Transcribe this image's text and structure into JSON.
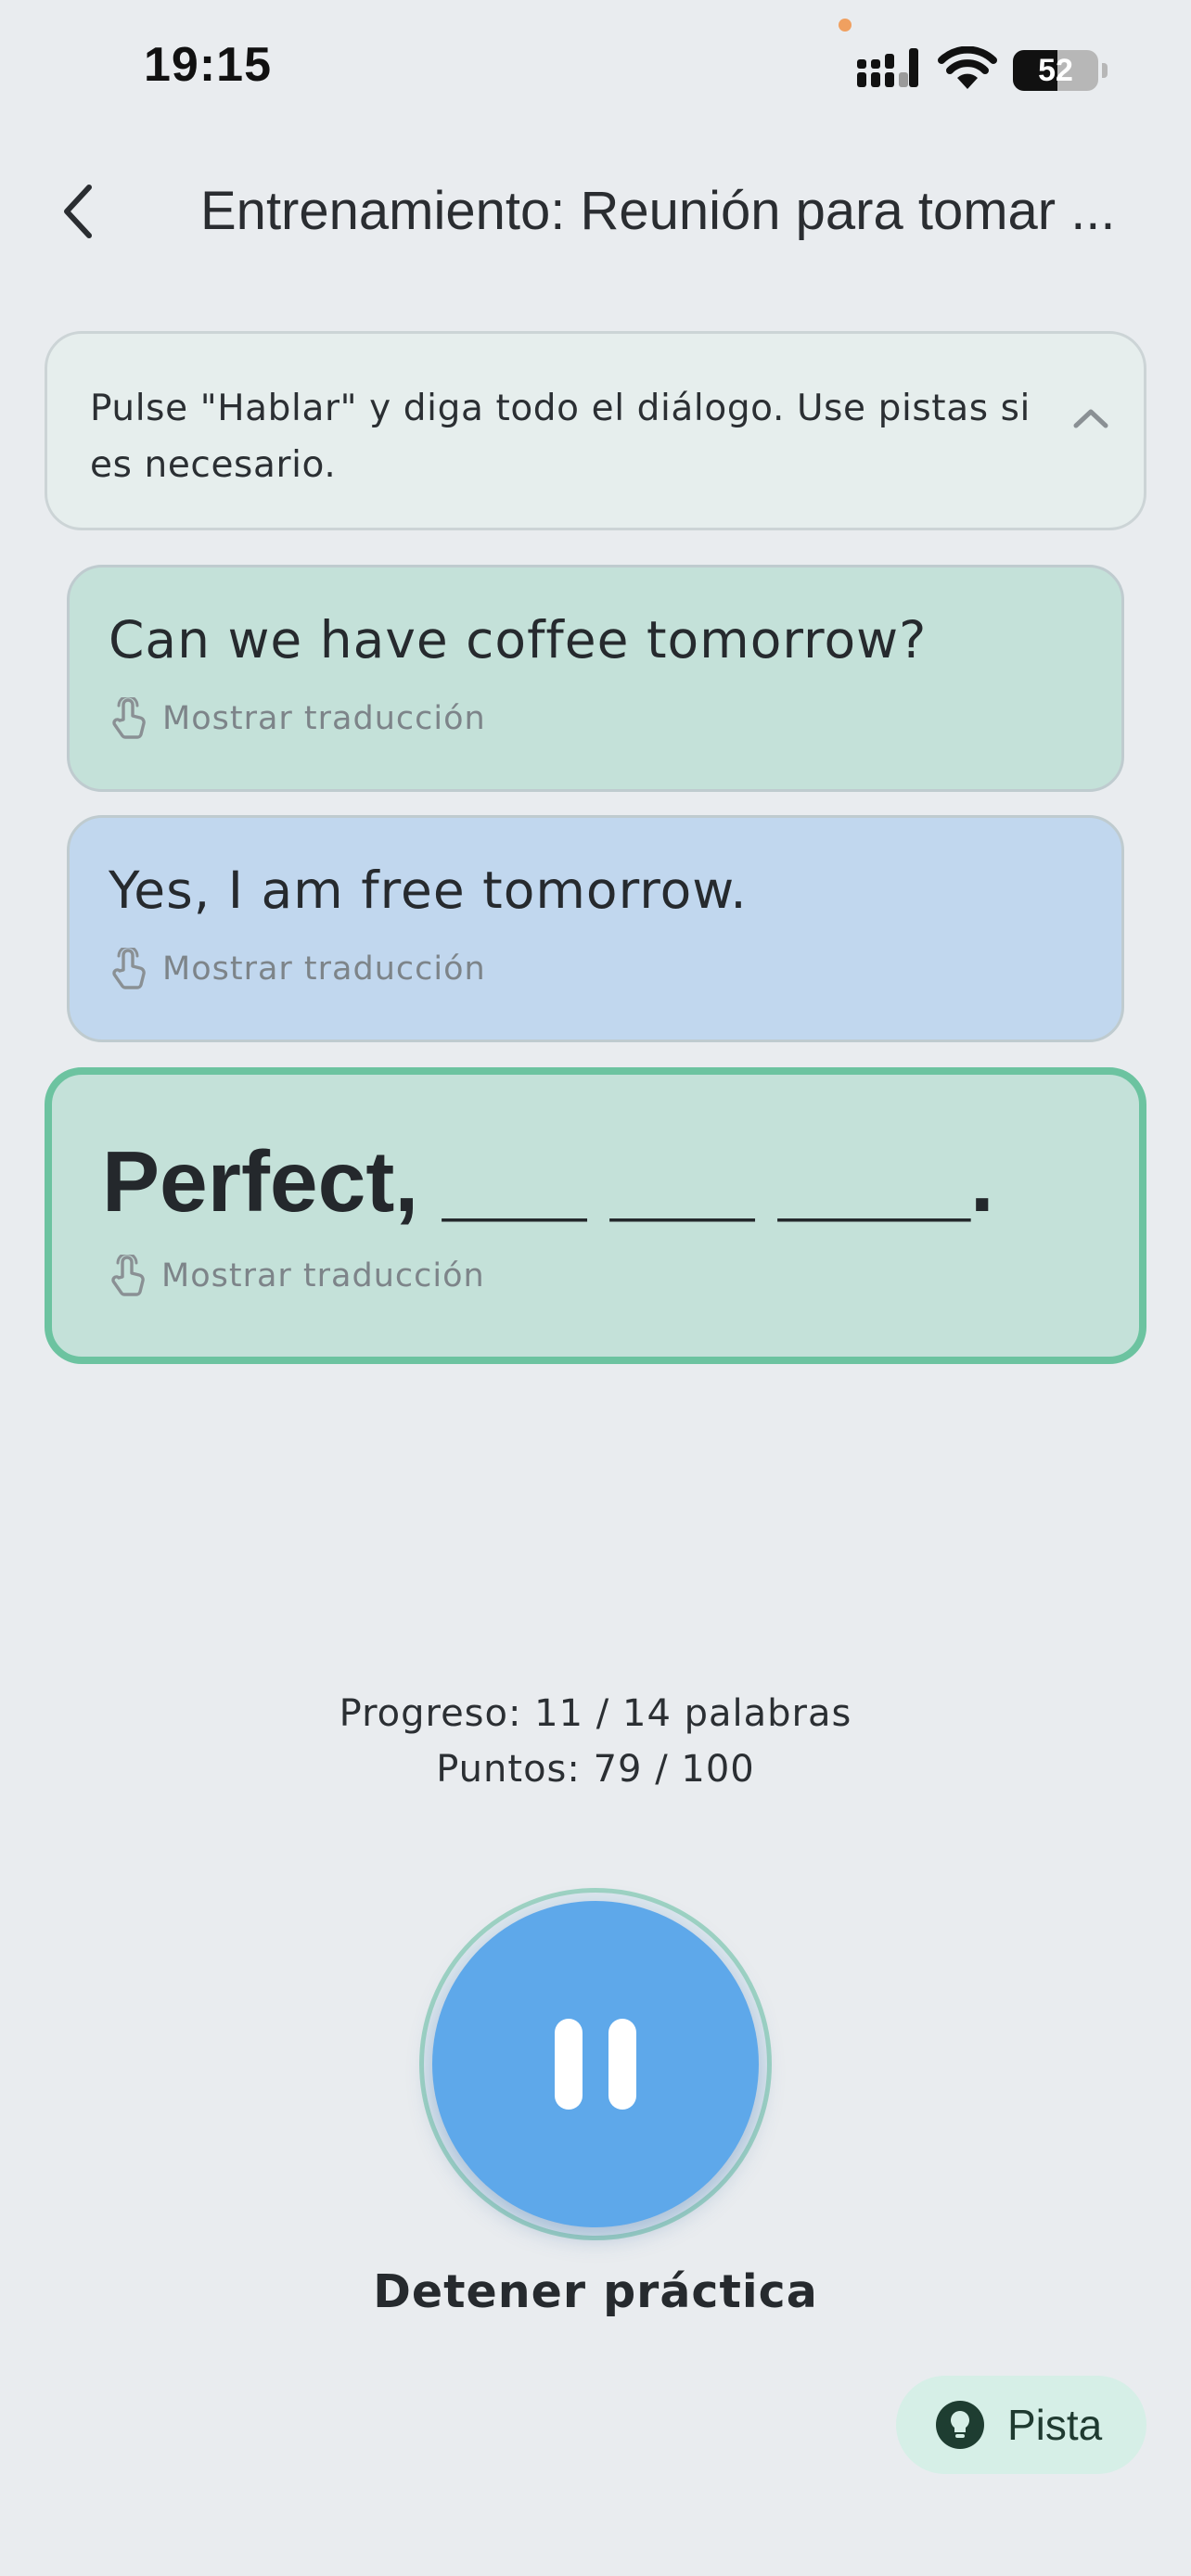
{
  "status_bar": {
    "time": "19:15",
    "battery": "52",
    "battery_level": 0.52
  },
  "header": {
    "title": "Entrenamiento: Reunión para tomar ..."
  },
  "instruction": {
    "text": "Pulse \"Hablar\" y diga todo el diálogo. Use pistas si es necesario."
  },
  "dialogue": [
    {
      "text": "Can we have coffee tomorrow?",
      "translation_label": "Mostrar traducción"
    },
    {
      "text": "Yes, I am free tomorrow.",
      "translation_label": "Mostrar traducción"
    }
  ],
  "active_line": {
    "text": "Perfect, ___ ___ ____.",
    "translation_label": "Mostrar traducción"
  },
  "progress": {
    "words": "Progreso: 11 / 14 palabras",
    "points": "Puntos: 79 / 100"
  },
  "controls": {
    "stop_label": "Detener práctica",
    "hint_label": "Pista"
  },
  "colors": {
    "background": "#e9ecef",
    "partner_card": "#c4e1d9",
    "user_card": "#c1d7ee",
    "active_border": "#6cc3a0",
    "primary_button": "#5ea8ea",
    "hint_bg": "#d6efe7"
  },
  "icons": {
    "back": "chevron-left-icon",
    "collapse": "chevron-up-icon",
    "translate": "tap-hand-icon",
    "pause": "pause-icon",
    "hint": "lightbulb-icon"
  }
}
